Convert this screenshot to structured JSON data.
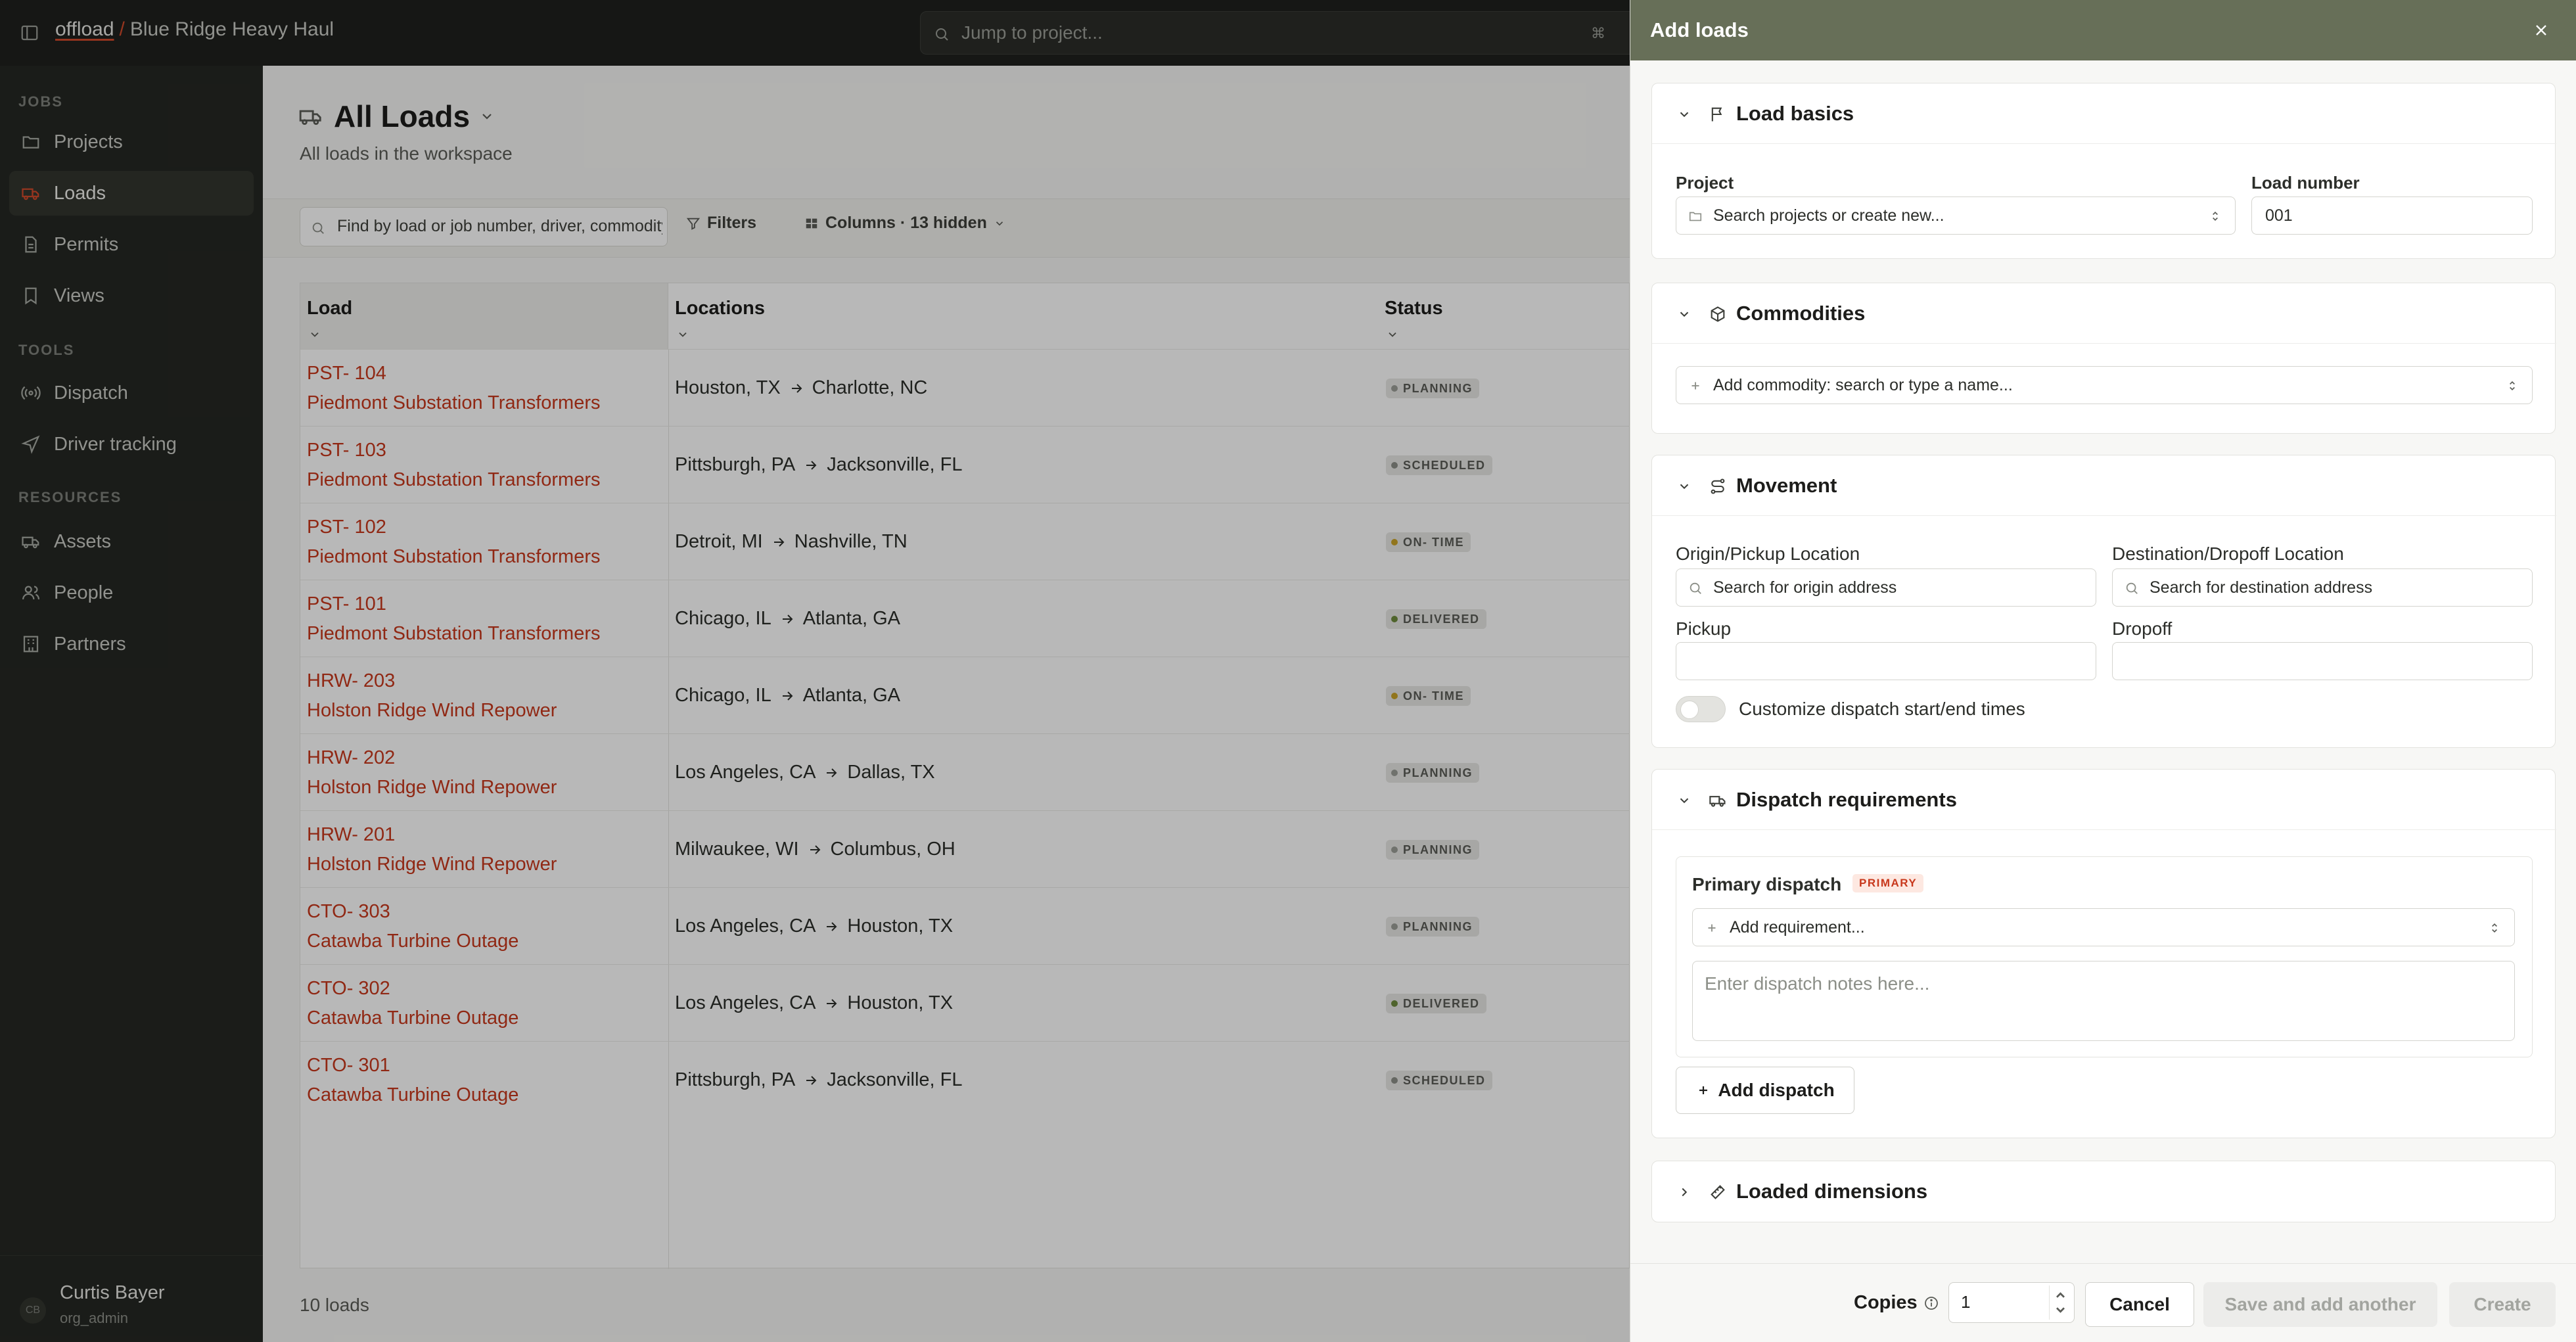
{
  "topbar": {
    "brand": "offload",
    "separator": "/",
    "workspace": "Blue Ridge Heavy Haul",
    "jump_placeholder": "Jump to project...",
    "jump_shortcut": "⌘"
  },
  "sidebar": {
    "sections": [
      {
        "label": "JOBS"
      },
      {
        "label": "TOOLS"
      },
      {
        "label": "RESOURCES"
      }
    ],
    "items": [
      {
        "label": "Projects",
        "icon": "folder-icon"
      },
      {
        "label": "Loads",
        "icon": "truck-icon",
        "active": true
      },
      {
        "label": "Permits",
        "icon": "document-icon"
      },
      {
        "label": "Views",
        "icon": "bookmark-icon"
      },
      {
        "label": "Dispatch",
        "icon": "radio-icon"
      },
      {
        "label": "Driver tracking",
        "icon": "navigation-icon"
      },
      {
        "label": "Assets",
        "icon": "truck-icon"
      },
      {
        "label": "People",
        "icon": "people-icon"
      },
      {
        "label": "Partners",
        "icon": "building-icon"
      }
    ],
    "user": {
      "initials": "CB",
      "name": "Curtis Bayer",
      "role": "org_admin"
    }
  },
  "main": {
    "title": "All Loads",
    "subtitle": "All loads in the workspace",
    "search_placeholder": "Find by load or job number, driver, commodity",
    "filters_label": "Filters",
    "columns_label": "Columns · 13  hidden",
    "columns": [
      "Load",
      "Locations",
      "Status"
    ],
    "rows": [
      {
        "code": "PST- 104",
        "project": "Piedmont Substation Transformers",
        "origin": "Houston, TX",
        "destination": "Charlotte, NC",
        "status": "PLANNING"
      },
      {
        "code": "PST- 103",
        "project": "Piedmont Substation Transformers",
        "origin": "Pittsburgh, PA",
        "destination": "Jacksonville, FL",
        "status": "SCHEDULED"
      },
      {
        "code": "PST- 102",
        "project": "Piedmont Substation Transformers",
        "origin": "Detroit, MI",
        "destination": "Nashville, TN",
        "status": "ON- TIME"
      },
      {
        "code": "PST- 101",
        "project": "Piedmont Substation Transformers",
        "origin": "Chicago, IL",
        "destination": "Atlanta, GA",
        "status": "DELIVERED"
      },
      {
        "code": "HRW- 203",
        "project": "Holston Ridge Wind Repower",
        "origin": "Chicago, IL",
        "destination": "Atlanta, GA",
        "status": "ON- TIME"
      },
      {
        "code": "HRW- 202",
        "project": "Holston Ridge Wind Repower",
        "origin": "Los Angeles, CA",
        "destination": "Dallas, TX",
        "status": "PLANNING"
      },
      {
        "code": "HRW- 201",
        "project": "Holston Ridge Wind Repower",
        "origin": "Milwaukee, WI",
        "destination": "Columbus, OH",
        "status": "PLANNING"
      },
      {
        "code": "CTO- 303",
        "project": "Catawba Turbine Outage",
        "origin": "Los Angeles, CA",
        "destination": "Houston, TX",
        "status": "PLANNING"
      },
      {
        "code": "CTO- 302",
        "project": "Catawba Turbine Outage",
        "origin": "Los Angeles, CA",
        "destination": "Houston, TX",
        "status": "DELIVERED"
      },
      {
        "code": "CTO- 301",
        "project": "Catawba Turbine Outage",
        "origin": "Pittsburgh, PA",
        "destination": "Jacksonville, FL",
        "status": "SCHEDULED"
      }
    ],
    "footer_count": "10  loads",
    "status_colors": {
      "PLANNING": "#9c9e98",
      "SCHEDULED": "#8c8f88",
      "ON- TIME": "#c9a227",
      "DELIVERED": "#6e8b3d"
    }
  },
  "drawer": {
    "title": "Add loads",
    "sections": {
      "basics": {
        "title": "Load basics",
        "project_label": "Project",
        "project_placeholder": "Search projects or create new...",
        "load_number_label": "Load number",
        "load_number_value": "001"
      },
      "commodities": {
        "title": "Commodities",
        "add_placeholder": "Add commodity: search or type a name..."
      },
      "movement": {
        "title": "Movement",
        "origin_label": "Origin/Pickup Location",
        "origin_placeholder": "Search for origin address",
        "dest_label": "Destination/Dropoff Location",
        "dest_placeholder": "Search for destination address",
        "pickup_label": "Pickup",
        "pickup_value": "",
        "dropoff_label": "Dropoff",
        "dropoff_value": "",
        "toggle_label": "Customize dispatch start/end times",
        "toggle_on": false
      },
      "dispatch": {
        "title": "Dispatch requirements",
        "primary_title": "Primary dispatch",
        "primary_tag": "PRIMARY",
        "requirement_placeholder": "Add requirement...",
        "notes_placeholder": "Enter dispatch notes here...",
        "add_dispatch": "Add dispatch"
      },
      "dimensions": {
        "title": "Loaded dimensions"
      }
    },
    "footer": {
      "copies_label": "Copies",
      "copies_value": "1",
      "cancel": "Cancel",
      "save_another": "Save and add another",
      "create": "Create"
    }
  }
}
